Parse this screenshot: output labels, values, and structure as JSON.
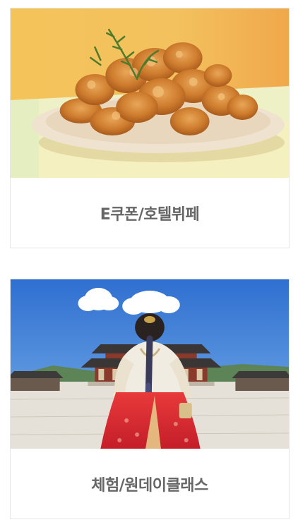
{
  "categories": [
    {
      "label": "E쿠폰/호텔뷔페",
      "image": "fried-chicken-plate-image"
    },
    {
      "label": "체험/원데이클래스",
      "image": "hanbok-palace-image"
    }
  ],
  "colors": {
    "label_text": "#666666",
    "card_border": "#e6e6e6"
  }
}
